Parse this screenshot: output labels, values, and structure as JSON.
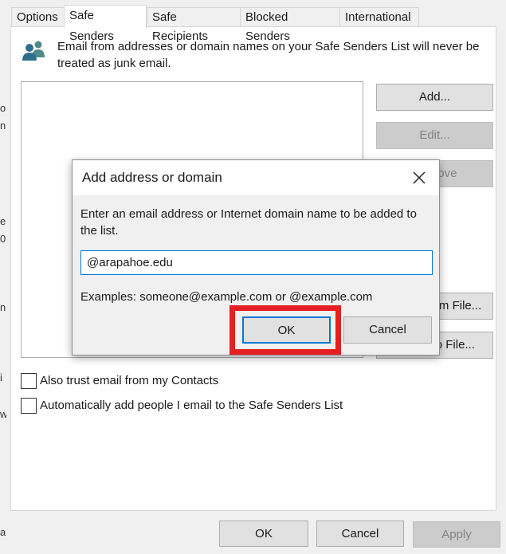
{
  "left_edge_fragments": [
    "o",
    "n",
    "e",
    "0",
    "n",
    "i",
    "w",
    "a"
  ],
  "tabs": [
    "Options",
    "Safe Senders",
    "Safe Recipients",
    "Blocked Senders",
    "International"
  ],
  "description": "Email from addresses or domain names on your Safe Senders List will never be treated as junk email.",
  "side_buttons": {
    "add": "Add...",
    "edit": "Edit...",
    "remove": "Remove",
    "import": "Import from File...",
    "export": "Export to File..."
  },
  "checkboxes": {
    "trust_contacts": {
      "label": "Also trust email from my Contacts",
      "checked": false
    },
    "auto_add": {
      "label": "Automatically add people I email to the Safe Senders List",
      "checked": false
    }
  },
  "footer": {
    "ok": "OK",
    "cancel": "Cancel",
    "apply": "Apply"
  },
  "dialog": {
    "title": "Add address or domain",
    "prompt": "Enter an email address or Internet domain name to be added to the list.",
    "input_value": "@arapahoe.edu",
    "examples": "Examples: someone@example.com or @example.com",
    "ok": "OK",
    "cancel": "Cancel"
  },
  "colors": {
    "highlight": "#e51f23",
    "focus": "#0078d7"
  }
}
